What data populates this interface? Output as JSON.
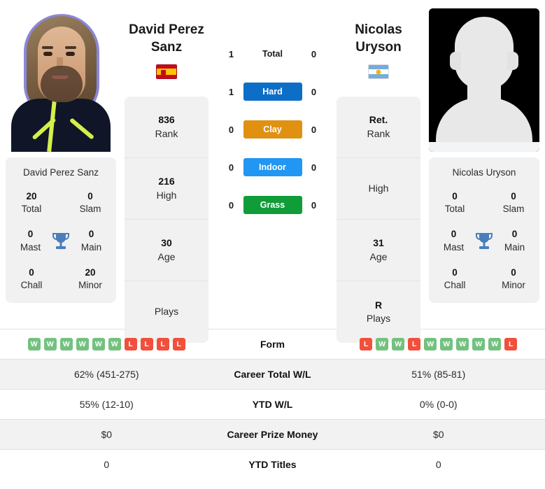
{
  "players": {
    "left": {
      "name": "David Perez Sanz",
      "name_line1": "David Perez",
      "name_line2": "Sanz",
      "country": "Spain",
      "flag_icon": "flag-spain-icon",
      "photo_type": "player-photo",
      "summary_name": "David Perez Sanz",
      "titles": {
        "total_value": "20",
        "total_label": "Total",
        "slam_value": "0",
        "slam_label": "Slam",
        "mast_value": "0",
        "mast_label": "Mast",
        "main_value": "0",
        "main_label": "Main",
        "chall_value": "0",
        "chall_label": "Chall",
        "minor_value": "20",
        "minor_label": "Minor"
      },
      "profile": {
        "rank_value": "836",
        "rank_label": "Rank",
        "high_value": "216",
        "high_label": "High",
        "age_value": "30",
        "age_label": "Age",
        "plays_value": "",
        "plays_label": "Plays"
      },
      "form": [
        "W",
        "W",
        "W",
        "W",
        "W",
        "W",
        "L",
        "L",
        "L",
        "L"
      ],
      "career_total_wl": "62% (451-275)",
      "ytd_wl": "55% (12-10)",
      "career_prize_money": "$0",
      "ytd_titles": "0",
      "surface_scores": {
        "total": "1",
        "hard": "1",
        "clay": "0",
        "indoor": "0",
        "grass": "0"
      }
    },
    "right": {
      "name": "Nicolas Uryson",
      "name_line1": "Nicolas",
      "name_line2": "Uryson",
      "country": "Argentina",
      "flag_icon": "flag-argentina-icon",
      "photo_type": "placeholder-silhouette",
      "summary_name": "Nicolas Uryson",
      "titles": {
        "total_value": "0",
        "total_label": "Total",
        "slam_value": "0",
        "slam_label": "Slam",
        "mast_value": "0",
        "mast_label": "Mast",
        "main_value": "0",
        "main_label": "Main",
        "chall_value": "0",
        "chall_label": "Chall",
        "minor_value": "0",
        "minor_label": "Minor"
      },
      "profile": {
        "rank_value": "Ret.",
        "rank_label": "Rank",
        "high_value": "",
        "high_label": "High",
        "age_value": "31",
        "age_label": "Age",
        "plays_value": "R",
        "plays_label": "Plays"
      },
      "form": [
        "L",
        "W",
        "W",
        "L",
        "W",
        "W",
        "W",
        "W",
        "W",
        "L"
      ],
      "career_total_wl": "51% (85-81)",
      "ytd_wl": "0% (0-0)",
      "career_prize_money": "$0",
      "ytd_titles": "0",
      "surface_scores": {
        "total": "0",
        "hard": "0",
        "clay": "0",
        "indoor": "0",
        "grass": "0"
      }
    }
  },
  "surfaces": [
    {
      "key": "total",
      "label": "Total",
      "color": "transparent",
      "plain": true
    },
    {
      "key": "hard",
      "label": "Hard",
      "color": "#0d6ec8",
      "plain": false
    },
    {
      "key": "clay",
      "label": "Clay",
      "color": "#e09112",
      "plain": false
    },
    {
      "key": "indoor",
      "label": "Indoor",
      "color": "#2196f3",
      "plain": false
    },
    {
      "key": "grass",
      "label": "Grass",
      "color": "#109c38",
      "plain": false
    }
  ],
  "table_labels": {
    "form": "Form",
    "career_total_wl": "Career Total W/L",
    "ytd_wl": "YTD W/L",
    "career_prize_money": "Career Prize Money",
    "ytd_titles": "YTD Titles"
  },
  "colors": {
    "win_badge": "#74c17f",
    "loss_badge": "#f0503c",
    "card_bg": "#f1f1f1",
    "row_alt_bg": "#f2f2f2",
    "trophy": "#4a7ebb"
  }
}
